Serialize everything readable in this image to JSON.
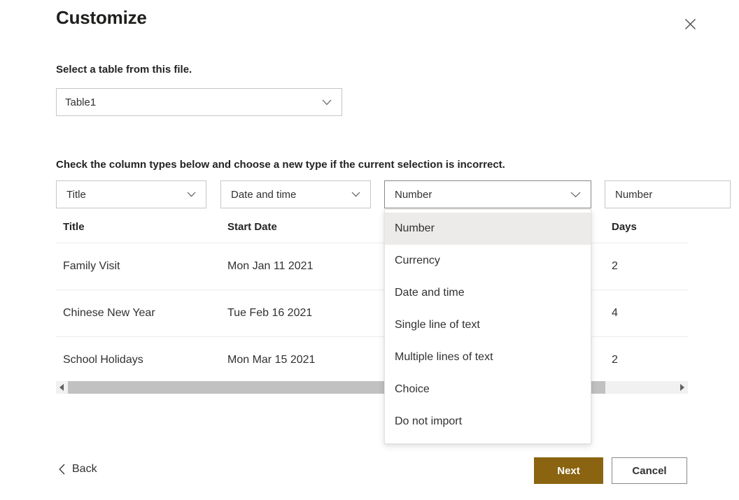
{
  "dialog": {
    "title": "Customize",
    "close_label": "Close",
    "close_icon": "close-icon"
  },
  "table_picker": {
    "label": "Select a table from this file.",
    "value": "Table1",
    "chevron_icon": "chevron-down-icon"
  },
  "columns_section": {
    "instruction": "Check the column types below and choose a new type if the current selection is incorrect.",
    "type_selects": [
      {
        "value": "Title",
        "chevron_icon": "chevron-down-icon"
      },
      {
        "value": "Date and time",
        "chevron_icon": "chevron-down-icon"
      },
      {
        "value": "Number",
        "chevron_icon": "chevron-down-icon"
      },
      {
        "value": "Number",
        "chevron_icon": "chevron-down-icon"
      }
    ]
  },
  "dropdown_menu": {
    "open": true,
    "selected": "Number",
    "options": [
      "Number",
      "Currency",
      "Date and time",
      "Single line of text",
      "Multiple lines of text",
      "Choice",
      "Do not import"
    ]
  },
  "preview_table": {
    "headers": [
      "Title",
      "Start Date",
      "",
      "Days"
    ],
    "rows": [
      {
        "title": "Family Visit",
        "start_date": "Mon Jan 11 2021",
        "hidden": "",
        "days": "2"
      },
      {
        "title": "Chinese New Year",
        "start_date": "Tue Feb 16 2021",
        "hidden": "",
        "days": "4"
      },
      {
        "title": "School Holidays",
        "start_date": "Mon Mar 15 2021",
        "hidden": "",
        "days": "2"
      }
    ]
  },
  "scrollbar": {
    "left_arrow_icon": "caret-left-icon",
    "right_arrow_icon": "caret-right-icon"
  },
  "footer": {
    "back_label": "Back",
    "back_icon": "chevron-left-icon",
    "next_label": "Next",
    "cancel_label": "Cancel"
  },
  "colors": {
    "accent": "#8a6410",
    "border": "#c8c6c4",
    "row_divider": "#edebe9",
    "menu_selected": "#edebe9",
    "scroll_thumb": "#c1c1c1",
    "text": "#323130"
  }
}
